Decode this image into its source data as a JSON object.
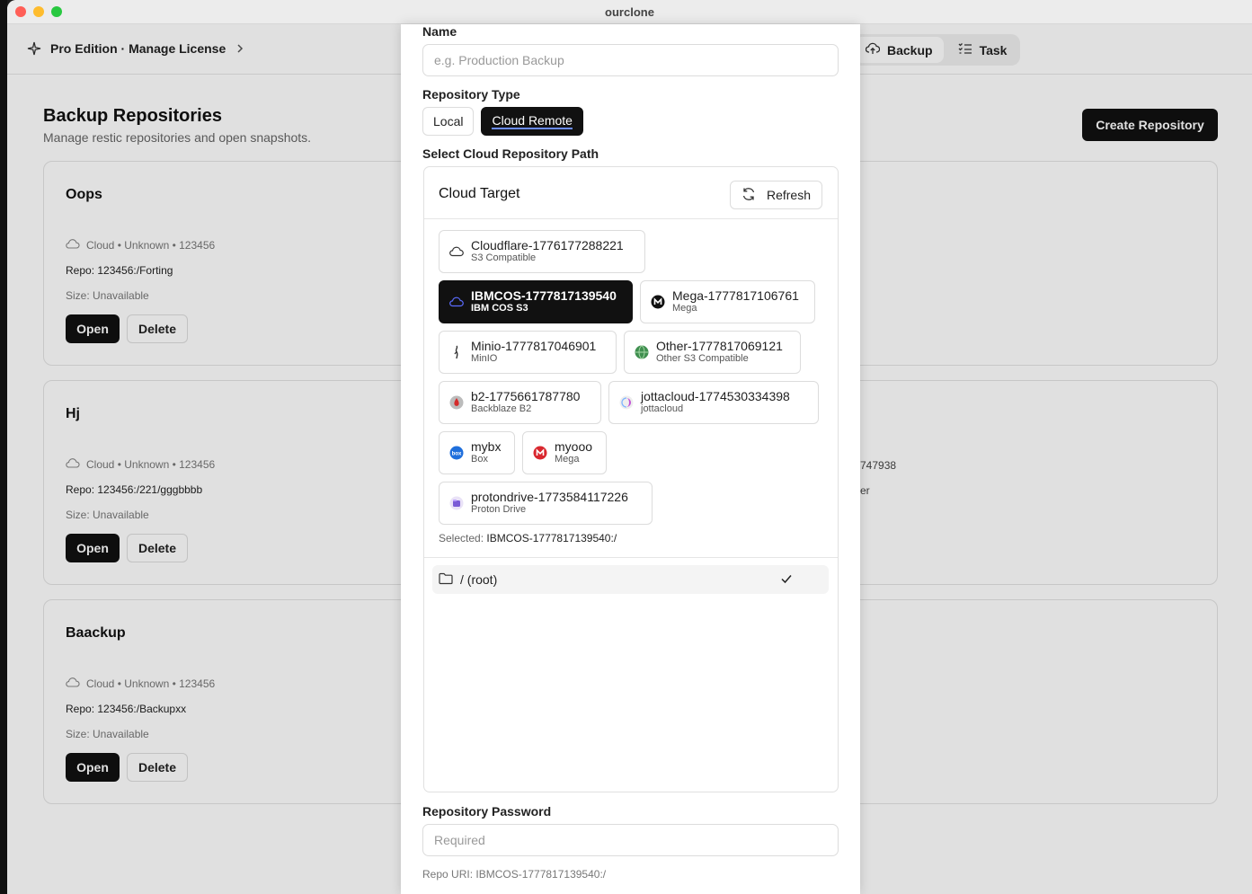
{
  "window": {
    "title": "ourclone"
  },
  "header": {
    "edition": "Pro Edition · Manage License",
    "tabs": [
      {
        "label": "Backup"
      },
      {
        "label": "Task"
      }
    ]
  },
  "page": {
    "title": "Backup Repositories",
    "subtitle": "Manage restic repositories and open snapshots.",
    "create_label": "Create Repository"
  },
  "repos": [
    {
      "name": "Oops",
      "meta": "Cloud • Unknown • 123456",
      "path": "Repo: 123456:/Forting",
      "size": "Size: Unavailable"
    },
    {
      "name": "Hj",
      "meta": "Cloud • Unknown • 123456",
      "path": "Repo: 123456:/221/gggbbbb",
      "size": "Size: Unavailable"
    },
    {
      "name": "Baackup",
      "meta": "Cloud • Unknown • 123456",
      "path": "Repo: 123456:/Backupxx",
      "size": "Size: Unavailable"
    }
  ],
  "repo_buttons": {
    "open": "Open",
    "delete": "Delete"
  },
  "background_fragments": {
    "frag1": "747938",
    "frag2": "er"
  },
  "modal": {
    "name_label": "Name",
    "name_placeholder": "e.g. Production Backup",
    "type_label": "Repository Type",
    "type_options": [
      "Local",
      "Cloud Remote"
    ],
    "type_selected": "Cloud Remote",
    "path_label": "Select Cloud Repository Path",
    "cloud_target_title": "Cloud Target",
    "refresh_label": "Refresh",
    "targets": [
      {
        "name": "Cloudflare-1776177288221",
        "type": "S3 Compatible",
        "icon": "cloud-icon"
      },
      {
        "name": "IBMCOS-1777817139540",
        "type": "IBM COS S3",
        "icon": "ibm-icon"
      },
      {
        "name": "Mega-1777817106761",
        "type": "Mega",
        "icon": "mega-icon"
      },
      {
        "name": "Minio-1777817046901",
        "type": "MinIO",
        "icon": "minio-icon"
      },
      {
        "name": "Other-1777817069121",
        "type": "Other S3 Compatible",
        "icon": "globe-icon"
      },
      {
        "name": "b2-1775661787780",
        "type": "Backblaze B2",
        "icon": "backblaze-icon"
      },
      {
        "name": "jottacloud-1774530334398",
        "type": "jottacloud",
        "icon": "jottacloud-icon"
      },
      {
        "name": "mybx",
        "type": "Box",
        "icon": "box-icon"
      },
      {
        "name": "myooo",
        "type": "Mega",
        "icon": "mega-red-icon"
      },
      {
        "name": "protondrive-1773584117226",
        "type": "Proton Drive",
        "icon": "proton-icon"
      }
    ],
    "selected_prefix": "Selected:",
    "selected_value": "IBMCOS-1777817139540:/",
    "folder_label": "/ (root)",
    "password_label": "Repository Password",
    "password_placeholder": "Required",
    "repo_uri": "Repo URI: IBMCOS-1777817139540:/"
  },
  "colors": {
    "accent": "#111111",
    "brand_link": "#6b8dff"
  }
}
